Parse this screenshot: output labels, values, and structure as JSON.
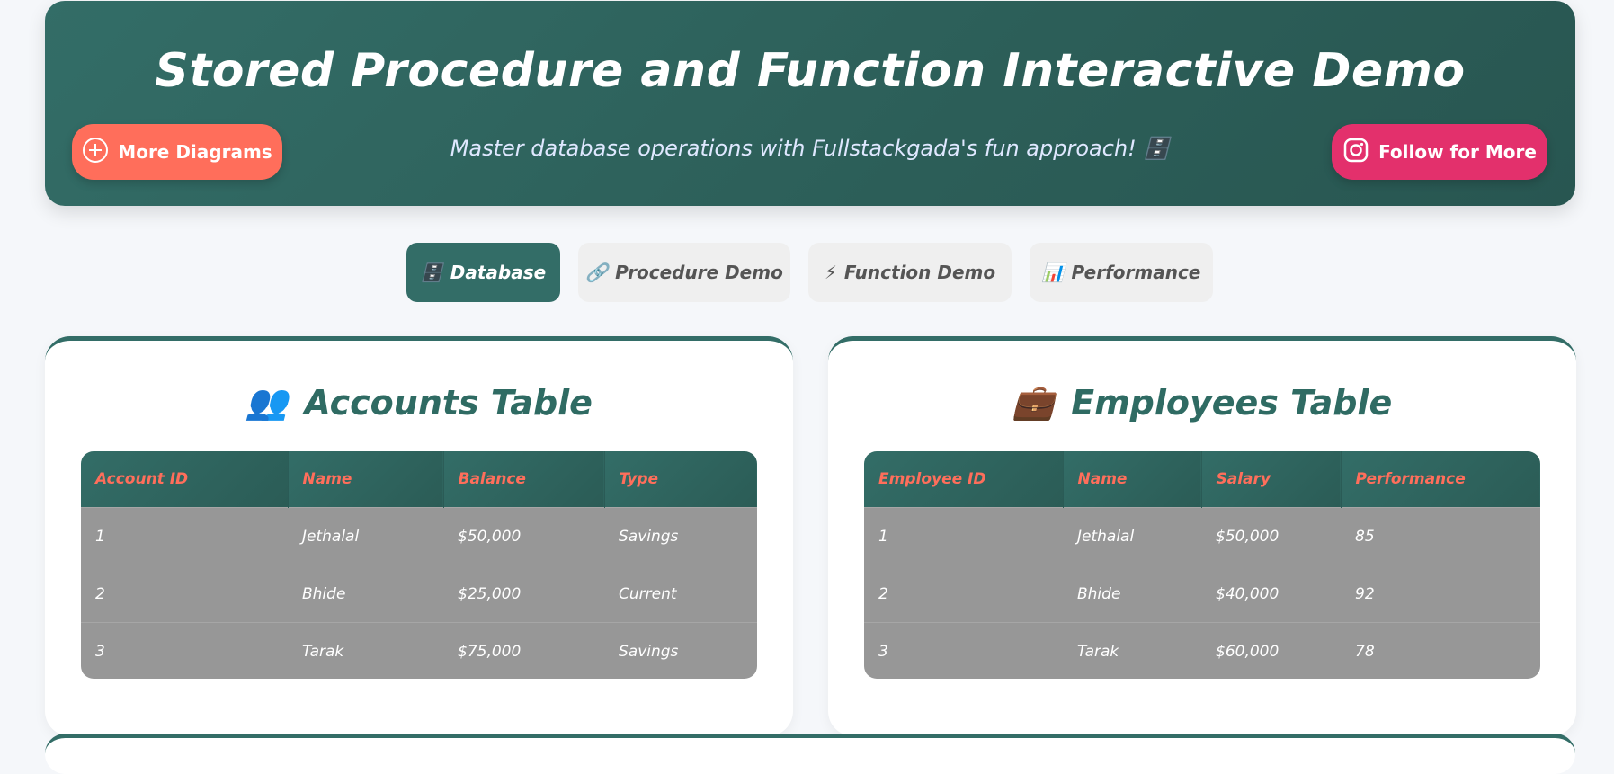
{
  "header": {
    "title": "Stored Procedure and Function Interactive Demo",
    "subtitle": "Master database operations with Fullstackgada's fun approach! 🗄️",
    "more_button": "More Diagrams",
    "follow_button": "Follow for More"
  },
  "tabs": [
    {
      "icon": "🗄️",
      "label": "Database"
    },
    {
      "icon": "🔗",
      "label": "Procedure Demo"
    },
    {
      "icon": "⚡",
      "label": "Function Demo"
    },
    {
      "icon": "📊",
      "label": "Performance"
    }
  ],
  "accounts": {
    "icon": "👥",
    "title": "Accounts Table",
    "columns": [
      "Account ID",
      "Name",
      "Balance",
      "Type"
    ],
    "rows": [
      [
        "1",
        "Jethalal",
        "$50,000",
        "Savings"
      ],
      [
        "2",
        "Bhide",
        "$25,000",
        "Current"
      ],
      [
        "3",
        "Tarak",
        "$75,000",
        "Savings"
      ]
    ]
  },
  "employees": {
    "icon": "💼",
    "title": "Employees Table",
    "columns": [
      "Employee ID",
      "Name",
      "Salary",
      "Performance"
    ],
    "rows": [
      [
        "1",
        "Jethalal",
        "$50,000",
        "85"
      ],
      [
        "2",
        "Bhide",
        "$40,000",
        "92"
      ],
      [
        "3",
        "Tarak",
        "$60,000",
        "78"
      ]
    ]
  }
}
